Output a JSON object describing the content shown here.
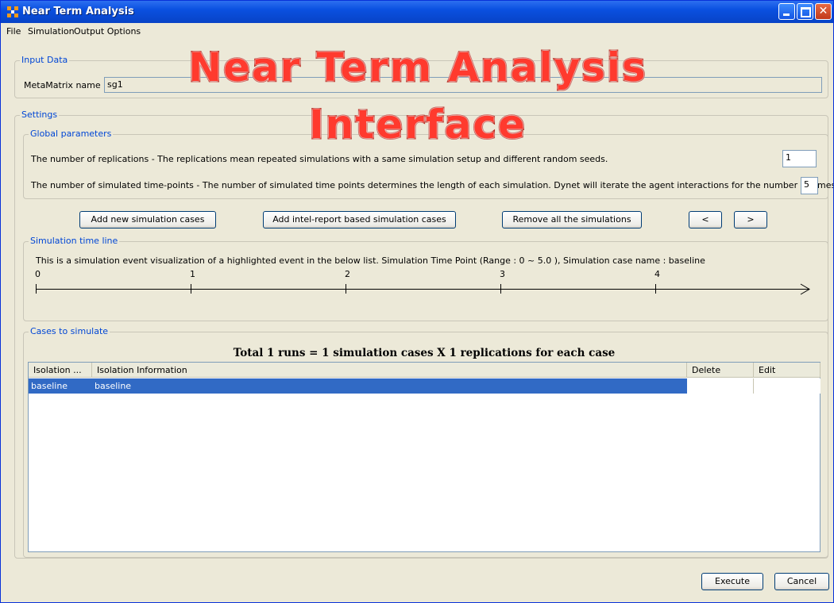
{
  "window": {
    "title": "Near Term Analysis",
    "close_glyph": "✕"
  },
  "menu": [
    "File",
    "Simulation",
    "Output Options"
  ],
  "input_data": {
    "group_label": "Input Data",
    "metamatrix_label": "MetaMatrix name",
    "metamatrix_value": "sg1"
  },
  "settings": {
    "group_label": "Settings",
    "global": {
      "group_label": "Global parameters",
      "replications_label": "The number of replications - The replications mean repeated simulations with a same simulation setup and different random seeds.",
      "replications_value": "1",
      "timepoints_label": "The number of simulated time-points - The number of simulated time points determines the length of each simulation. Dynet will iterate the agent interactions for the number of times",
      "timepoints_value": "5"
    }
  },
  "buttons": {
    "add_cases": "Add new simulation cases",
    "add_intel": "Add intel-report based simulation cases",
    "remove_all": "Remove all the simulations",
    "prev": "<",
    "next": ">",
    "execute": "Execute",
    "cancel": "Cancel"
  },
  "timeline": {
    "group_label": "Simulation time line",
    "description": "This is a simulation event visualization of a highlighted event in the below list. Simulation Time Point (Range : 0 ~ 5.0 ), Simulation case name : baseline",
    "ticks": [
      "0",
      "1",
      "2",
      "3",
      "4"
    ]
  },
  "cases": {
    "group_label": "Cases to simulate",
    "summary": "Total 1 runs = 1 simulation cases X 1 replications for each case",
    "columns": [
      "Isolation ...",
      "Isolation Information",
      "Delete",
      "Edit"
    ],
    "rows": [
      {
        "isolation": "baseline",
        "info": "baseline",
        "delete": "",
        "edit": ""
      }
    ]
  },
  "overlay": {
    "line1": "Near Term Analysis",
    "line2": "Interface"
  },
  "colors": {
    "selection": "#316ac5",
    "overlay_text": "#ff3a2e",
    "group_label": "#0046d5"
  }
}
